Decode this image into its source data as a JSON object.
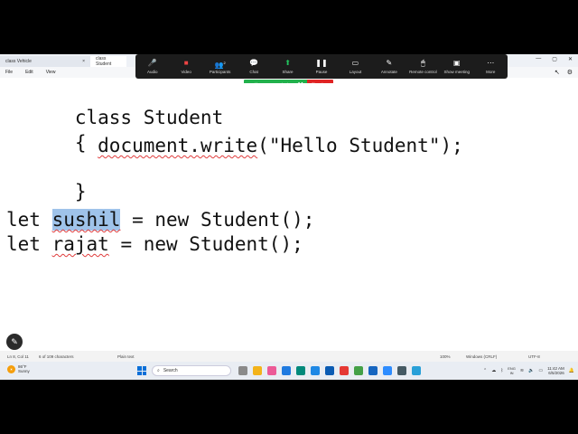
{
  "notepad": {
    "tabs": [
      {
        "label": "class Vehicle"
      },
      {
        "label": "class Student"
      }
    ],
    "menu": [
      "File",
      "Edit",
      "View"
    ]
  },
  "zoom_toolbar": {
    "items": [
      {
        "label": "Audio",
        "icon": "microphone-icon"
      },
      {
        "label": "Video",
        "icon": "video-off-icon"
      },
      {
        "label": "Participants",
        "icon": "participants-icon",
        "badge": "2"
      },
      {
        "label": "Chat",
        "icon": "chat-icon"
      },
      {
        "label": "Share",
        "icon": "share-screen-icon"
      },
      {
        "label": "Pause",
        "icon": "pause-icon"
      },
      {
        "label": "Layout",
        "icon": "layout-icon"
      },
      {
        "label": "Annotate",
        "icon": "pen-icon"
      },
      {
        "label": "Remote control",
        "icon": "remote-control-icon"
      },
      {
        "label": "Show meeting",
        "icon": "show-meeting-icon"
      },
      {
        "label": "More",
        "icon": "more-icon"
      }
    ],
    "banner": "You are screen sharing",
    "stop_label": "Stop share"
  },
  "editor": {
    "lines": {
      "l1": "class Student",
      "l2": "{",
      "l3_indent": "        ",
      "l3_call": "document.write",
      "l3_rest": "(\"Hello Student\");",
      "l4": "}",
      "l5_kw": "let ",
      "l5_var": "sushil",
      "l5_rest": " = new Student();",
      "l6_kw": "let ",
      "l6_var": "rajat",
      "l6_rest": " = new Student();"
    }
  },
  "statusbar": {
    "position": "Ln 8, Col 11",
    "selection": "6 of 109 characters",
    "format": "Plain text",
    "zoom": "100%",
    "line_ending": "Windows (CRLF)",
    "encoding": "UTF-8"
  },
  "taskbar": {
    "weather_temp": "86°F",
    "weather_desc": "Sunny",
    "search_placeholder": "Search",
    "lang_top": "ENG",
    "lang_bottom": "IN",
    "time": "11:42 AM",
    "date": "6/5/2026"
  },
  "colors": {
    "selection": "#9fc3ea",
    "squiggle": "#e03c3c",
    "share_green": "#22b14c",
    "stop_red": "#e02424"
  }
}
